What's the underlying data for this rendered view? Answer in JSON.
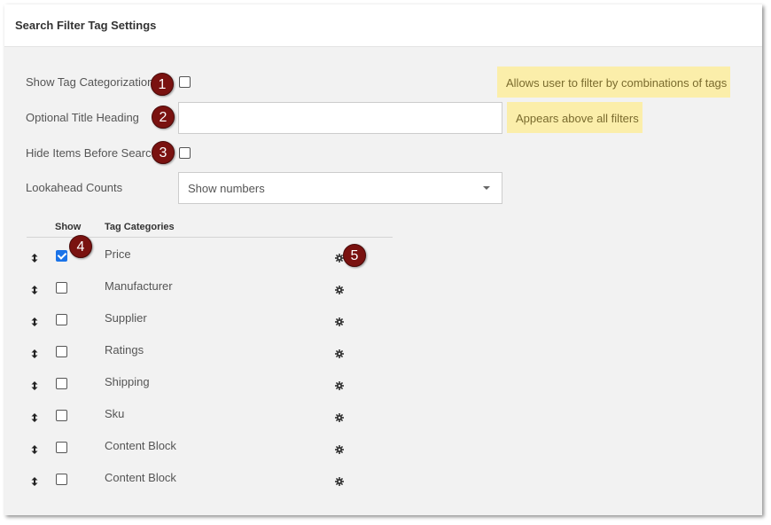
{
  "panel": {
    "title": "Search Filter Tag Settings"
  },
  "fields": {
    "show_tag_categorization": {
      "label": "Show Tag Categorization",
      "checked": false,
      "hint": "Allows user to filter by combinations of tags"
    },
    "optional_title_heading": {
      "label": "Optional Title Heading",
      "value": "",
      "hint": "Appears above all filters"
    },
    "hide_items_before_search": {
      "label": "Hide Items Before Search",
      "checked": false
    },
    "lookahead_counts": {
      "label": "Lookahead Counts",
      "selected": "Show numbers"
    }
  },
  "table": {
    "headers": {
      "show": "Show",
      "tag_categories": "Tag Categories"
    },
    "rows": [
      {
        "label": "Price",
        "show": true
      },
      {
        "label": "Manufacturer",
        "show": false
      },
      {
        "label": "Supplier",
        "show": false
      },
      {
        "label": "Ratings",
        "show": false
      },
      {
        "label": "Shipping",
        "show": false
      },
      {
        "label": "Sku",
        "show": false
      },
      {
        "label": "Content Block",
        "show": false
      },
      {
        "label": "Content Block",
        "show": false
      }
    ]
  },
  "callouts": [
    "1",
    "2",
    "3",
    "4",
    "5"
  ],
  "icons": {
    "drag": "drag-handle-icon",
    "settings": "gear-icon"
  },
  "colors": {
    "callout": "#7a1210",
    "hint_background": "#fbeeaa",
    "checkbox_checked": "#1a73e8"
  }
}
